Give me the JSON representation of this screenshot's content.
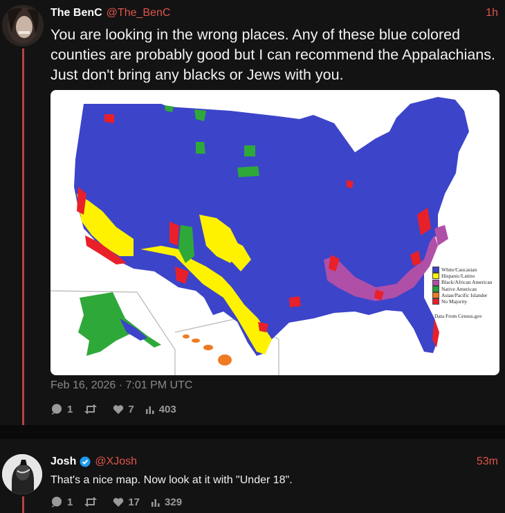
{
  "post1": {
    "author_name": "The BenC",
    "handle": "@The_BenC",
    "time": "1h",
    "text": "You are looking in the wrong places. Any of these blue colored counties are probably good but I can recommend the Appalachians. Just don't bring any blacks or Jews with you.",
    "date": "Feb 16, 2026 · 7:01 PM UTC",
    "replies": "1",
    "likes": "7",
    "views": "403",
    "map": {
      "legend": [
        {
          "label": "White/Caucasian",
          "color": "#3b44c8"
        },
        {
          "label": "Hispanic/Latino",
          "color": "#fff200"
        },
        {
          "label": "Black/African American",
          "color": "#b04fa8"
        },
        {
          "label": "Native American",
          "color": "#23a33a"
        },
        {
          "label": "Asian/Pacific Islander",
          "color": "#ee7a22"
        },
        {
          "label": "No Majority",
          "color": "#e8202a"
        }
      ],
      "source": "Data From Census.gov"
    }
  },
  "post2": {
    "author_name": "Josh",
    "handle": "@XJosh",
    "time": "53m",
    "text": "That's a nice map. Now look at it with \"Under 18\".",
    "replies": "1",
    "likes": "17",
    "views": "329"
  },
  "icons": {
    "reply": "comment-icon",
    "retweet": "retweet-icon",
    "like": "heart-icon",
    "views": "bar-chart-icon",
    "verified": "verified-badge-icon"
  }
}
